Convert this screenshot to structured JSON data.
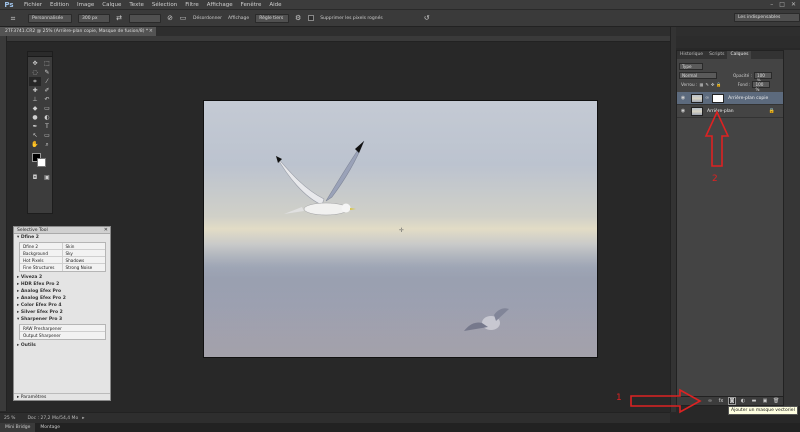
{
  "app": {
    "logo": "Ps",
    "menu": [
      "Fichier",
      "Edition",
      "Image",
      "Calque",
      "Texte",
      "Sélection",
      "Filtre",
      "Affichage",
      "Fenêtre",
      "Aide"
    ],
    "window_controls": [
      "–",
      "□",
      "✕"
    ]
  },
  "options_bar": {
    "style_value": "Personnalisée",
    "size_value": "300 px",
    "extra_value": "",
    "refine_label": "Désordonner",
    "view_label": "Affichage",
    "view_value": "Règle tiers",
    "delete_pixels_label": "Supprimer les pixels rognés",
    "workspace_value": "Les indispensables"
  },
  "document": {
    "tab_title": "2TF3741.CR2 @ 25% (Arrière-plan copie, Masque de fusion/8) *",
    "zoom": "25 %",
    "status": "Doc : 27,2 Mo/54,4 Mo"
  },
  "selective_tool": {
    "title": "Selective Tool",
    "dfine_section": "Dfine 2",
    "table": [
      [
        "Dfine 2",
        "Skin"
      ],
      [
        "Background",
        "Sky"
      ],
      [
        "Hot Pixels",
        "Shadows"
      ],
      [
        "Fine Structures",
        "Strong Noise"
      ]
    ],
    "plugins": [
      "Viveza 2",
      "HDR Efex Pro 2",
      "Analog Efex Pro",
      "Analog Efex Pro 2",
      "Color Efex Pro 4",
      "Silver Efex Pro 2",
      "Sharpener Pro 3"
    ],
    "sharpener_table": [
      [
        "RAW Presharpener"
      ],
      [
        "Output Sharpener"
      ]
    ],
    "outils_label": "Outils",
    "footer_label": "Paramètres"
  },
  "layers_panel": {
    "tabs": [
      "Historique",
      "Scripts",
      "Calques"
    ],
    "active_tab": "Calques",
    "kind_value": "Type",
    "blend_value": "Normal",
    "opacity_label": "Opacité :",
    "opacity_value": "100 %",
    "lock_label": "Verrou :",
    "fill_label": "Fond :",
    "fill_value": "100 %",
    "layers": [
      {
        "name": "Arrière-plan copie",
        "selected": true,
        "has_mask": true
      },
      {
        "name": "Arrière-plan",
        "selected": false,
        "locked": true
      }
    ],
    "footer_buttons": [
      "link-icon",
      "fx-icon",
      "mask-icon",
      "adjustment-icon",
      "group-icon",
      "new-layer-icon",
      "trash-icon"
    ],
    "tooltip": "Ajouter un masque vectoriel"
  },
  "bottom_tabs": [
    "Mini Bridge",
    "Montage"
  ],
  "annotations": {
    "label_1": "1",
    "label_2": "2",
    "color": "#dd2222"
  }
}
